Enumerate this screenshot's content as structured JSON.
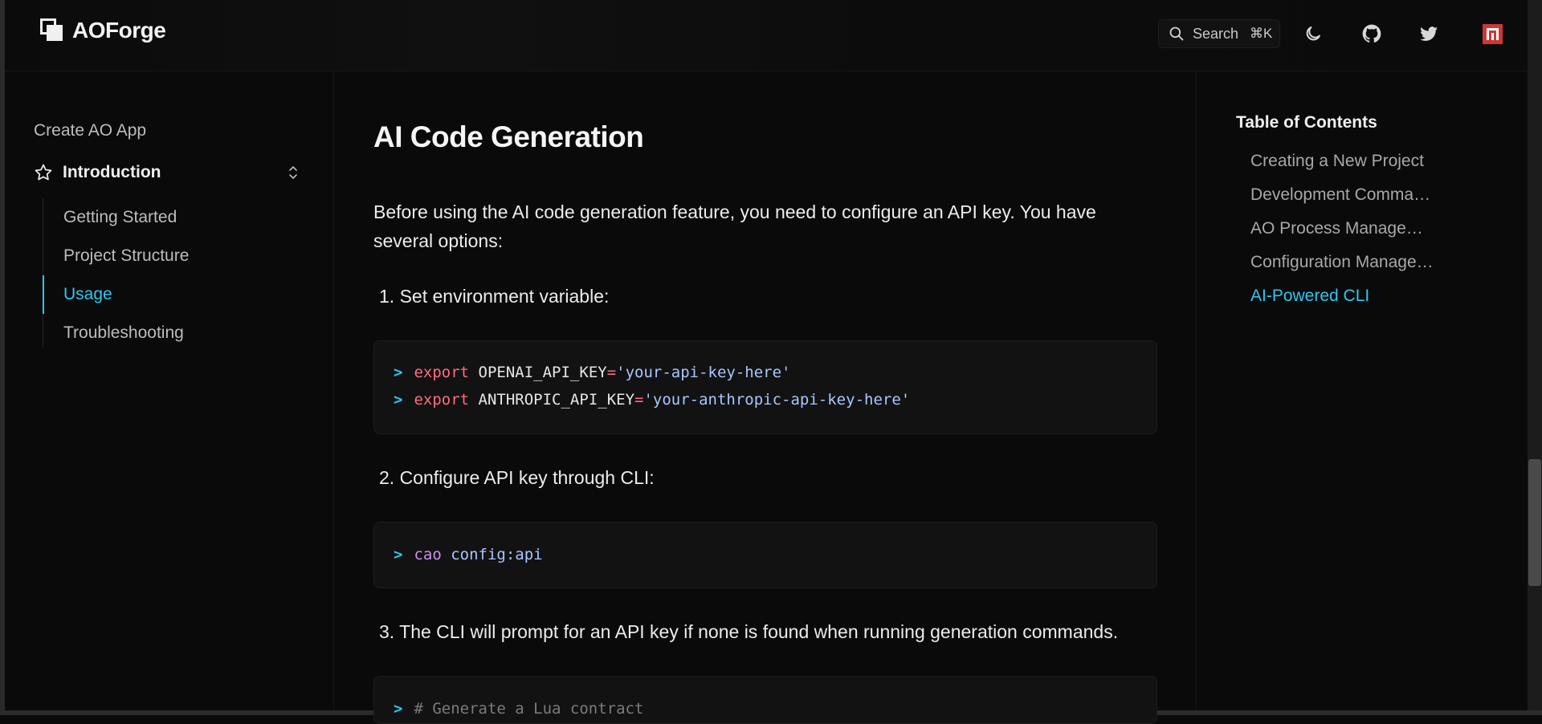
{
  "brand": {
    "name": "AOForge"
  },
  "header": {
    "search_label": "Search",
    "search_shortcut": "⌘K",
    "icons": [
      "search-icon",
      "moon-icon",
      "github-icon",
      "twitter-icon",
      "npm-icon"
    ]
  },
  "sidebar": {
    "top_link": "Create AO App",
    "section": {
      "label": "Introduction",
      "icon": "star-icon"
    },
    "items": [
      {
        "label": "Getting Started"
      },
      {
        "label": "Project Structure"
      },
      {
        "label": "Usage"
      },
      {
        "label": "Troubleshooting"
      }
    ],
    "active_item": "Usage"
  },
  "main": {
    "title": "AI Code Generation",
    "intro": "Before using the AI code generation feature, you need to configure an API key. You have several options:",
    "steps": [
      {
        "label": "1. Set environment variable:",
        "code": [
          {
            "prompt": ">",
            "keyword": "export",
            "variable": "OPENAI_API_KEY",
            "equals": "=",
            "value": "'your-api-key-here'"
          },
          {
            "prompt": ">",
            "keyword": "export",
            "variable": "ANTHROPIC_API_KEY",
            "equals": "=",
            "value": "'your-anthropic-api-key-here'"
          }
        ]
      },
      {
        "label": "2. Configure API key through CLI:",
        "code": [
          {
            "prompt": ">",
            "command": "cao",
            "argument": "config:api"
          }
        ]
      },
      {
        "label": "3. The CLI will prompt for an API key if none is found when running generation commands.",
        "code": [
          {
            "prompt": ">",
            "comment": "# Generate a Lua contract"
          }
        ]
      }
    ]
  },
  "toc": {
    "title": "Table of Contents",
    "items": [
      {
        "label": "Creating a New Project"
      },
      {
        "label": "Development Commands"
      },
      {
        "label": "AO Process Management"
      },
      {
        "label": "Configuration Management"
      },
      {
        "label": "AI-Powered CLI"
      }
    ],
    "active_item": "AI-Powered CLI"
  },
  "colors": {
    "accent": "#2fc6ef",
    "keyword": "#ff6b81",
    "string": "#a9c6ff",
    "command": "#c792ea",
    "npm": "#cb3837"
  }
}
